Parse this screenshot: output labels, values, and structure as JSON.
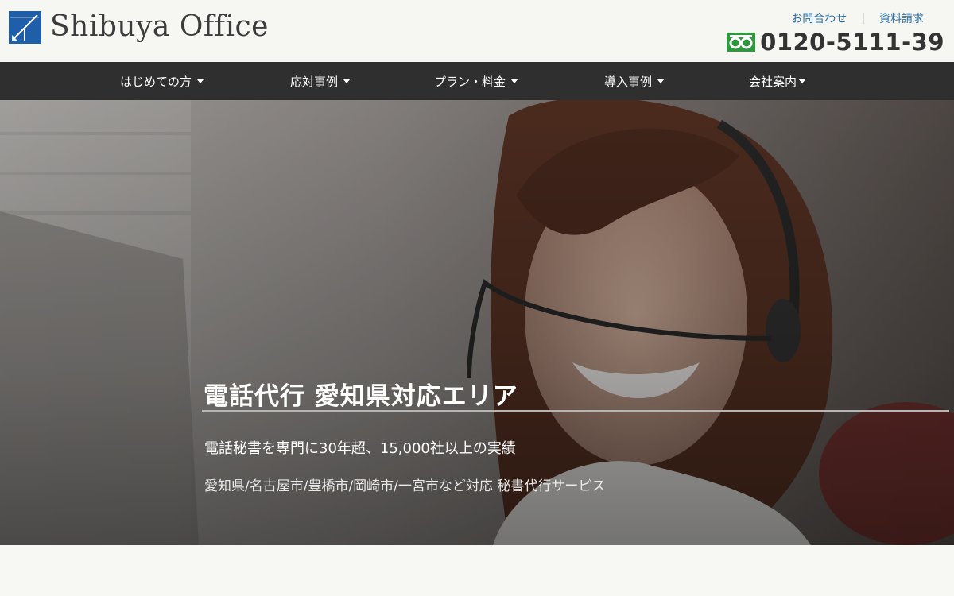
{
  "header": {
    "logo_text": "Shibuya Office",
    "top_links": [
      "お問合わせ",
      "資料請求"
    ],
    "separator": "|",
    "phone": "0120-5111-39",
    "phone_icon": "freedial-icon"
  },
  "nav": {
    "items": [
      {
        "label": "はじめての方"
      },
      {
        "label": "応対事例"
      },
      {
        "label": "プラン・料金"
      },
      {
        "label": "導入事例"
      },
      {
        "label": "会社案内"
      }
    ]
  },
  "hero": {
    "title": "電話代行 愛知県対応エリア",
    "subtitle": "電話秘書を専門に30年超、15,000社以上の実績",
    "area": "愛知県/名古屋市/豊橋市/岡崎市/一宮市など対応 秘書代行サービス"
  },
  "colors": {
    "nav_bg": "#2f2f2f",
    "link": "#2a6fa8",
    "logo_blue": "#1f5ea8",
    "freedial_green": "#2a9a3a"
  }
}
